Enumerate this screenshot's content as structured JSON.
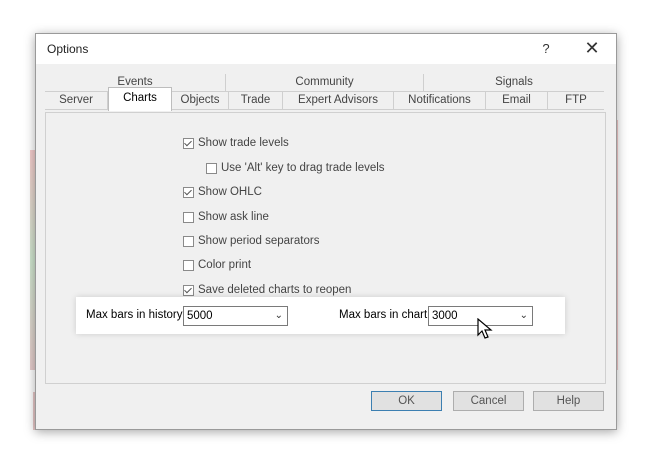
{
  "dialog": {
    "title": "Options",
    "help_label": "?",
    "close_label": "✕"
  },
  "tabs": {
    "top_row": [
      "Events",
      "Community",
      "Signals"
    ],
    "bottom_row": [
      "Server",
      "Charts",
      "Objects",
      "Trade",
      "Expert Advisors",
      "Notifications",
      "Email",
      "FTP"
    ],
    "active": "Charts"
  },
  "options": [
    {
      "label": "Show trade levels",
      "checked": true
    },
    {
      "label": "Use 'Alt' key to drag trade levels",
      "checked": false
    },
    {
      "label": "Show OHLC",
      "checked": true
    },
    {
      "label": "Show ask line",
      "checked": false
    },
    {
      "label": "Show period separators",
      "checked": false
    },
    {
      "label": "Color print",
      "checked": false
    },
    {
      "label": "Save deleted charts to reopen",
      "checked": true
    }
  ],
  "max_bars_history": {
    "label": "Max bars in history:",
    "value": "5000"
  },
  "max_bars_chart": {
    "label": "Max bars in chart:",
    "value": "3000"
  },
  "buttons": {
    "ok": "OK",
    "cancel": "Cancel",
    "help": "Help"
  },
  "colors": {
    "chart_green": "#55a855",
    "chart_red": "#e05a5a",
    "highlight": "#ffffff"
  }
}
